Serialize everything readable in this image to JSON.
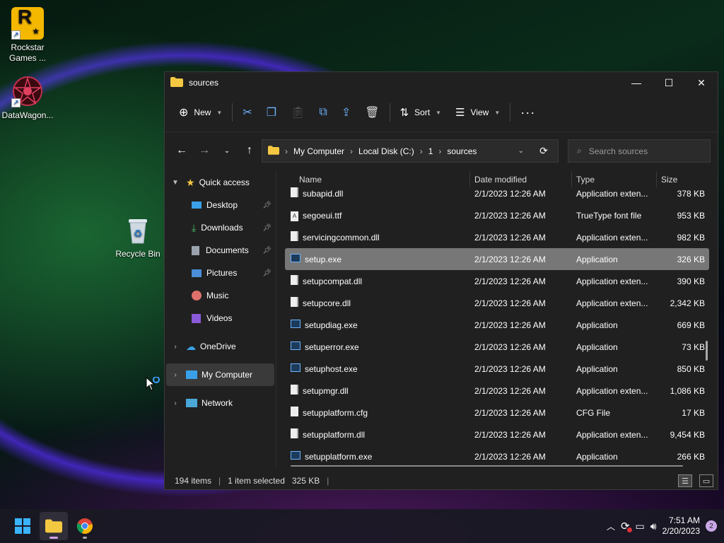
{
  "desktop": {
    "icons": [
      {
        "label": "Rockstar Games ...",
        "icon": "rockstar-logo"
      },
      {
        "label": "DataWagon...",
        "icon": "datawagon-logo"
      },
      {
        "label": "Recycle Bin",
        "icon": "recycle-bin"
      }
    ]
  },
  "window": {
    "title": "sources",
    "toolbar": {
      "new": "New",
      "sort": "Sort",
      "view": "View"
    },
    "breadcrumb": [
      "My Computer",
      "Local Disk (C:)",
      "1",
      "sources"
    ],
    "search_placeholder": "Search sources",
    "nav": [
      {
        "label": "Quick access"
      },
      {
        "label": "Desktop"
      },
      {
        "label": "Downloads"
      },
      {
        "label": "Documents"
      },
      {
        "label": "Pictures"
      },
      {
        "label": "Music"
      },
      {
        "label": "Videos"
      },
      {
        "label": "OneDrive"
      },
      {
        "label": "My Computer"
      },
      {
        "label": "Network"
      }
    ],
    "columns": [
      "Name",
      "Date modified",
      "Type",
      "Size"
    ],
    "rows": [
      {
        "name": "subapid.dll",
        "date": "2/1/2023 12:26 AM",
        "type": "Application exten...",
        "size": "378 KB"
      },
      {
        "name": "segoeui.ttf",
        "date": "2/1/2023 12:26 AM",
        "type": "TrueType font file",
        "size": "953 KB"
      },
      {
        "name": "servicingcommon.dll",
        "date": "2/1/2023 12:26 AM",
        "type": "Application exten...",
        "size": "982 KB"
      },
      {
        "name": "setup.exe",
        "date": "2/1/2023 12:26 AM",
        "type": "Application",
        "size": "326 KB"
      },
      {
        "name": "setupcompat.dll",
        "date": "2/1/2023 12:26 AM",
        "type": "Application exten...",
        "size": "390 KB"
      },
      {
        "name": "setupcore.dll",
        "date": "2/1/2023 12:26 AM",
        "type": "Application exten...",
        "size": "2,342 KB"
      },
      {
        "name": "setupdiag.exe",
        "date": "2/1/2023 12:26 AM",
        "type": "Application",
        "size": "669 KB"
      },
      {
        "name": "setuperror.exe",
        "date": "2/1/2023 12:26 AM",
        "type": "Application",
        "size": "73 KB"
      },
      {
        "name": "setuphost.exe",
        "date": "2/1/2023 12:26 AM",
        "type": "Application",
        "size": "850 KB"
      },
      {
        "name": "setupmgr.dll",
        "date": "2/1/2023 12:26 AM",
        "type": "Application exten...",
        "size": "1,086 KB"
      },
      {
        "name": "setupplatform.cfg",
        "date": "2/1/2023 12:26 AM",
        "type": "CFG File",
        "size": "17 KB"
      },
      {
        "name": "setupplatform.dll",
        "date": "2/1/2023 12:26 AM",
        "type": "Application exten...",
        "size": "9,454 KB"
      },
      {
        "name": "setupplatform.exe",
        "date": "2/1/2023 12:26 AM",
        "type": "Application",
        "size": "266 KB"
      }
    ],
    "selected_row": "setup.exe",
    "status": {
      "items": "194 items",
      "selected": "1 item selected",
      "size": "325 KB"
    }
  },
  "taskbar": {
    "time": "7:51 AM",
    "date": "2/20/2023",
    "notifications": "2"
  }
}
